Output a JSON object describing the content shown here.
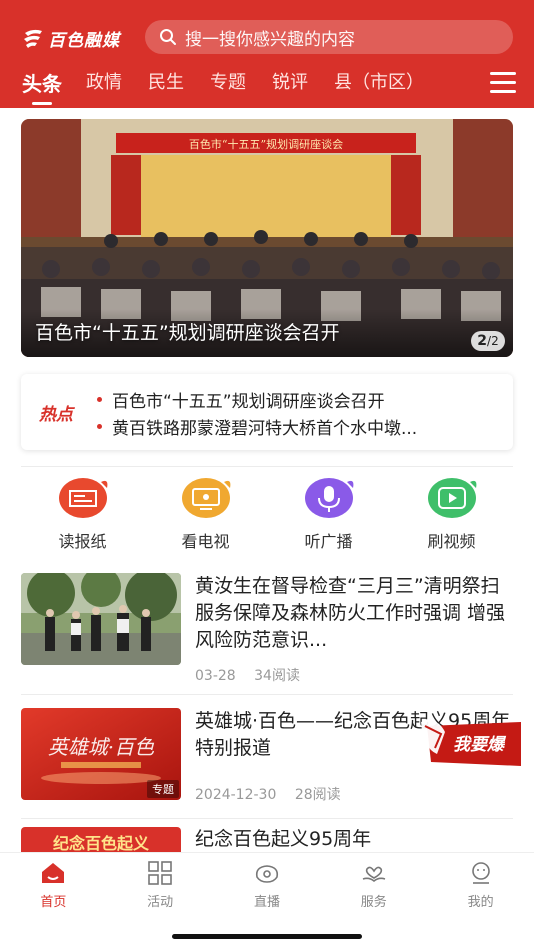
{
  "app": {
    "logo_text": "百色融媒",
    "search_placeholder": "搜一搜你感兴趣的内容",
    "tabs": [
      {
        "label": "头条",
        "active": true
      },
      {
        "label": "政情",
        "active": false
      },
      {
        "label": "民生",
        "active": false
      },
      {
        "label": "专题",
        "active": false
      },
      {
        "label": "锐评",
        "active": false
      },
      {
        "label": "县（市区）",
        "active": false
      }
    ],
    "accent_color": "#d8312a"
  },
  "banner": {
    "banner_text": "百色市“十五五”规划调研座谈会",
    "caption": "百色市“十五五”规划调研座谈会召开",
    "page_current": "2",
    "page_total": "/2"
  },
  "hot": {
    "label": "热点",
    "items": [
      "百色市“十五五”规划调研座谈会召开",
      "黄百铁路那蒙澄碧河特大桥首个水中墩..."
    ]
  },
  "quick_links": [
    {
      "label": "读报纸",
      "icon": "newspaper-icon"
    },
    {
      "label": "看电视",
      "icon": "tv-icon"
    },
    {
      "label": "听广播",
      "icon": "radio-icon"
    },
    {
      "label": "刷视频",
      "icon": "video-icon"
    }
  ],
  "news": [
    {
      "title": "黄汝生在督导检查“三月三”清明祭扫服务保障及森林防火工作时强调  增强风险防范意识...",
      "date": "03-28",
      "reads": "34阅读"
    },
    {
      "title": "英雄城·百色——纪念百色起义95周年特别报道",
      "date": "2024-12-30",
      "reads": "28阅读",
      "tag": "专题",
      "thumb_text": "英雄城·百色"
    },
    {
      "title": "纪念百色起义95周年",
      "thumb_text": "纪念百色起义"
    }
  ],
  "float_badge": "我要爆",
  "bottom_nav": [
    {
      "label": "首页",
      "icon": "home-icon",
      "active": true
    },
    {
      "label": "活动",
      "icon": "grid-icon",
      "active": false
    },
    {
      "label": "直播",
      "icon": "live-icon",
      "active": false
    },
    {
      "label": "服务",
      "icon": "heart-hand-icon",
      "active": false
    },
    {
      "label": "我的",
      "icon": "profile-icon",
      "active": false
    }
  ]
}
